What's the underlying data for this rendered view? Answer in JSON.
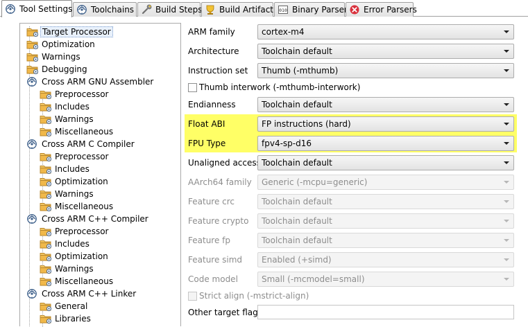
{
  "tabs": [
    {
      "label": "Tool Settings",
      "icon": "gear-icon",
      "active": true
    },
    {
      "label": "Toolchains",
      "icon": "gear-icon"
    },
    {
      "label": "Build Steps",
      "icon": "wrench-icon"
    },
    {
      "label": "Build Artifact",
      "icon": "artifact-icon"
    },
    {
      "label": "Binary Parsers",
      "icon": "binary-icon"
    },
    {
      "label": "Error Parsers",
      "icon": "error-icon"
    }
  ],
  "tree": [
    {
      "label": "Target Processor",
      "level": 1,
      "selected": true
    },
    {
      "label": "Optimization",
      "level": 1
    },
    {
      "label": "Warnings",
      "level": 1
    },
    {
      "label": "Debugging",
      "level": 1
    },
    {
      "label": "Cross ARM GNU Assembler",
      "level": 0
    },
    {
      "label": "Preprocessor",
      "level": 1
    },
    {
      "label": "Includes",
      "level": 1
    },
    {
      "label": "Warnings",
      "level": 1
    },
    {
      "label": "Miscellaneous",
      "level": 1
    },
    {
      "label": "Cross ARM C Compiler",
      "level": 0
    },
    {
      "label": "Preprocessor",
      "level": 1
    },
    {
      "label": "Includes",
      "level": 1
    },
    {
      "label": "Optimization",
      "level": 1
    },
    {
      "label": "Warnings",
      "level": 1
    },
    {
      "label": "Miscellaneous",
      "level": 1
    },
    {
      "label": "Cross ARM C++ Compiler",
      "level": 0
    },
    {
      "label": "Preprocessor",
      "level": 1
    },
    {
      "label": "Includes",
      "level": 1
    },
    {
      "label": "Optimization",
      "level": 1
    },
    {
      "label": "Warnings",
      "level": 1
    },
    {
      "label": "Miscellaneous",
      "level": 1
    },
    {
      "label": "Cross ARM C++ Linker",
      "level": 0
    },
    {
      "label": "General",
      "level": 1
    },
    {
      "label": "Libraries",
      "level": 1
    }
  ],
  "form": {
    "arm_family": {
      "label": "ARM family",
      "value": "cortex-m4"
    },
    "architecture": {
      "label": "Architecture",
      "value": "Toolchain default"
    },
    "instruction_set": {
      "label": "Instruction set",
      "value": "Thumb (-mthumb)"
    },
    "thumb_interwork": {
      "label": "Thumb interwork (-mthumb-interwork)",
      "checked": false
    },
    "endianness": {
      "label": "Endianness",
      "value": "Toolchain default"
    },
    "float_abi": {
      "label": "Float ABI",
      "value": "FP instructions (hard)"
    },
    "fpu_type": {
      "label": "FPU Type",
      "value": "fpv4-sp-d16"
    },
    "unaligned_access": {
      "label": "Unaligned access",
      "value": "Toolchain default"
    },
    "aarch64_family": {
      "label": "AArch64 family",
      "value": "Generic (-mcpu=generic)"
    },
    "feature_crc": {
      "label": "Feature crc",
      "value": "Toolchain default"
    },
    "feature_crypto": {
      "label": "Feature crypto",
      "value": "Toolchain default"
    },
    "feature_fp": {
      "label": "Feature fp",
      "value": "Toolchain default"
    },
    "feature_simd": {
      "label": "Feature simd",
      "value": "Enabled (+simd)"
    },
    "code_model": {
      "label": "Code model",
      "value": "Small (-mcmodel=small)"
    },
    "strict_align": {
      "label": "Strict align (-mstrict-align)",
      "checked": false
    },
    "other_target_flags": {
      "label": "Other target flags",
      "value": ""
    }
  },
  "colors": {
    "highlight": "#ffff66",
    "selection": "#e9f1fb",
    "folder": "#f0b84a"
  }
}
